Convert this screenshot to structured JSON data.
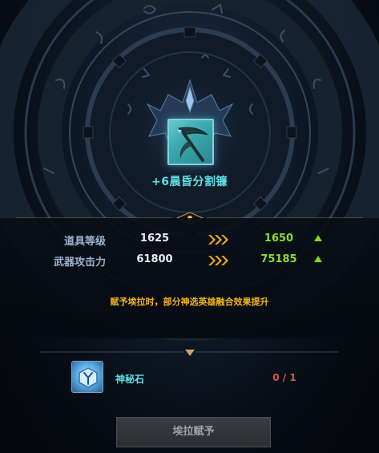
{
  "item": {
    "name": "+6晨昏分割镰",
    "icon": "scythe-icon"
  },
  "stats": [
    {
      "label": "道具等级",
      "current": "1625",
      "new": "1650"
    },
    {
      "label": "武器攻击力",
      "current": "61800",
      "new": "75185"
    }
  ],
  "notice": "赋予埃拉时，部分神选英雄融合效果提升",
  "material": {
    "name": "神秘石",
    "count": "0 / 1",
    "icon": "rune-stone-icon"
  },
  "action_button": {
    "label": "埃拉赋予"
  },
  "colors": {
    "item_name": "#5fe0e6",
    "new_value": "#8fdc2a",
    "notice": "#f0b51c",
    "missing_count": "#d65a4a"
  }
}
